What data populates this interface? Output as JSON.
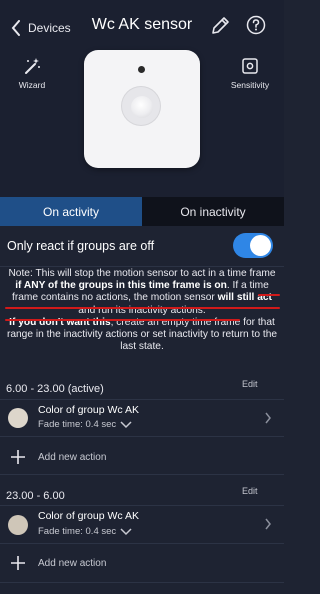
{
  "header": {
    "back_label": "Devices",
    "title": "Wc AK sensor",
    "wizard_label": "Wizard",
    "sensitivity_label": "Sensitivity"
  },
  "tabs": [
    {
      "label": "On activity",
      "active": true
    },
    {
      "label": "On inactivity",
      "active": false
    }
  ],
  "toggle": {
    "label": "Only react if groups are off",
    "on": true
  },
  "note": {
    "p1_a": "Note: This will stop the motion sensor to act in a time frame ",
    "p1_b": "if ANY of the groups in this time frame is on",
    "p1_c": ". If a time frame contains no actions, the motion sensor ",
    "p1_d": "will still act",
    "p1_e": " and run its inactivity actions.",
    "p2_a": "If you don't want this",
    "p2_b": ", create an empty time frame for that range in the inactivity actions or set inactivity to return to the last state."
  },
  "timeframes": [
    {
      "title": "6.00 - 23.00 (active)",
      "edit": "Edit",
      "action": {
        "name": "Color of group Wc AK",
        "fade": "Fade time: 0.4 sec",
        "color": "#ddd6cb"
      },
      "add": "Add new action"
    },
    {
      "title": "23.00 - 6.00",
      "edit": "Edit",
      "action": {
        "name": "Color of group Wc AK",
        "fade": "Fade time: 0.4 sec",
        "color": "#cfc6b8"
      },
      "add": "Add new action"
    }
  ],
  "colors": {
    "accent": "#2f86e6",
    "tab_active": "#1f4f88",
    "underline": "#d11a1a"
  }
}
